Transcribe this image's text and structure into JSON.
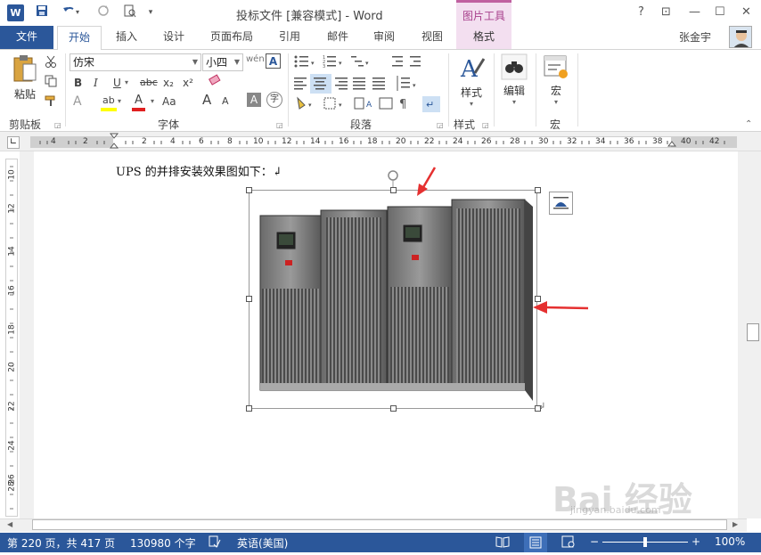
{
  "titlebar": {
    "app_icon": "W",
    "title": "投标文件 [兼容模式] - Word",
    "picture_tools": "图片工具",
    "help": "?",
    "controls": {
      "restore_ribbon": "⊡",
      "minimize": "—",
      "maximize": "☐",
      "close": "✕"
    }
  },
  "qat": {
    "save": "💾",
    "undo": "↶",
    "redo": "↻",
    "preview": "🔍",
    "more": "▾"
  },
  "tabs": {
    "file": "文件",
    "items": [
      "开始",
      "插入",
      "设计",
      "页面布局",
      "引用",
      "邮件",
      "审阅",
      "视图"
    ],
    "format": "格式",
    "active": "开始"
  },
  "user": {
    "name": "张金宇"
  },
  "ribbon": {
    "clipboard": {
      "paste": "粘贴",
      "label": "剪贴板"
    },
    "font": {
      "name": "仿宋",
      "size": "小四",
      "label": "字体",
      "bold": "B",
      "italic": "I",
      "underline": "U",
      "strike": "abc",
      "subscript": "x₂",
      "superscript": "x²",
      "grow": "A",
      "shrink": "A",
      "clear": "Aa",
      "effects": "A",
      "highlight": "ab",
      "color": "A",
      "case": "Aa",
      "phonetic": "wén",
      "border": "A"
    },
    "paragraph": {
      "label": "段落"
    },
    "styles": {
      "button": "样式",
      "label": "样式"
    },
    "editing": {
      "button": "编辑"
    },
    "macros": {
      "button": "宏",
      "label": "宏"
    }
  },
  "ruler": {
    "h_numbers": [
      "4",
      "2",
      "2",
      "4",
      "6",
      "8",
      "10",
      "12",
      "14",
      "16",
      "18",
      "20",
      "22",
      "24",
      "26",
      "28",
      "30",
      "32",
      "34",
      "36",
      "38",
      "40",
      "42"
    ],
    "v_numbers": [
      "10",
      "12",
      "14",
      "16",
      "18",
      "20",
      "22",
      "24",
      "26",
      "28"
    ]
  },
  "document": {
    "text": "UPS 的并排安装效果图如下：↲"
  },
  "status": {
    "page": "第 220 页，共 417 页",
    "words": "130980 个字",
    "language": "英语(美国)",
    "zoom": "100%",
    "zoom_minus": "−",
    "zoom_plus": "+"
  },
  "watermark": {
    "text": "Bai 经验",
    "sub": "jingyan.baidu.com"
  },
  "colors": {
    "accent": "#2b579a",
    "format_tab": "#f3dff0",
    "arrow": "#e53030"
  }
}
